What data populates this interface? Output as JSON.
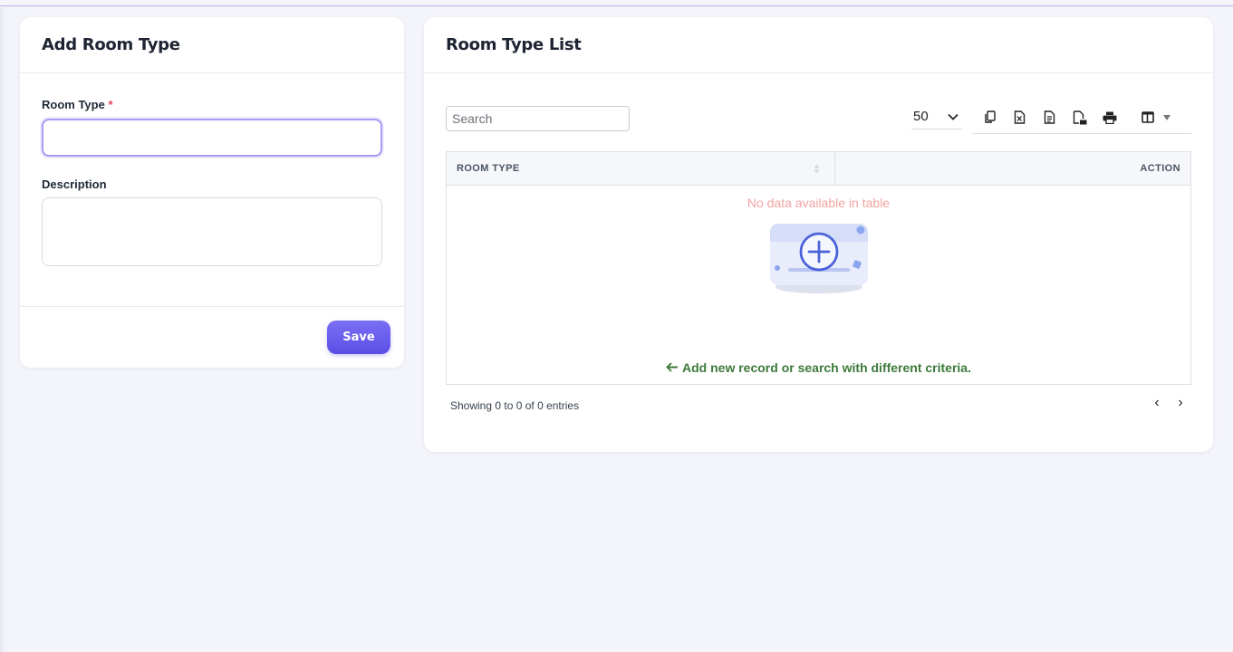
{
  "add_form": {
    "title": "Add Room Type",
    "room_type_label": "Room Type",
    "required_mark": "*",
    "room_type_value": "",
    "description_label": "Description",
    "description_value": "",
    "save_label": "Save"
  },
  "list": {
    "title": "Room Type List",
    "search_placeholder": "Search",
    "page_size": "50",
    "export_icons": [
      "copy-icon",
      "excel-icon",
      "csv-icon",
      "pdf-icon",
      "print-icon"
    ],
    "column_visibility_icon": "columns-icon",
    "columns": [
      "ROOM TYPE",
      "ACTION"
    ],
    "rows": [],
    "empty_message": "No data available in table",
    "empty_hint": "Add new record or search with different criteria.",
    "info": "Showing 0 to 0 of 0 entries",
    "prev_label": "‹",
    "next_label": "›"
  },
  "colors": {
    "accent": "#6558ec",
    "empty_message": "#f2a3a3",
    "hint": "#3d7a3a",
    "background": "#f4f5fa"
  }
}
